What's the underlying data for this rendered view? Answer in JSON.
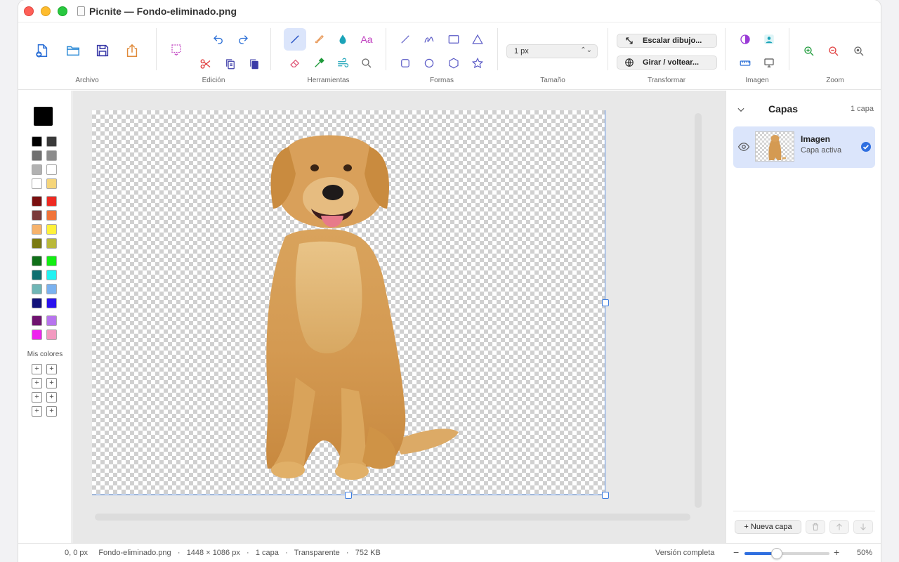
{
  "window": {
    "title": "Picnite — Fondo-eliminado.png"
  },
  "toolbar": {
    "groups": {
      "archivo": "Archivo",
      "edicion": "Edición",
      "herramientas": "Herramientas",
      "formas": "Formas",
      "tamano": "Tamaño",
      "transformar": "Transformar",
      "imagen": "Imagen",
      "zoom": "Zoom"
    },
    "size_value": "1 px",
    "scale_label": "Escalar dibujo...",
    "rotate_label": "Girar / voltear...",
    "text_tool_label": "Aa"
  },
  "colors": {
    "current": "#000000",
    "palette": [
      [
        "#000000",
        "#3a3a3a"
      ],
      [
        "#707070",
        "#8c8c8c"
      ],
      [
        "#b2b2b2",
        "#ffffff"
      ],
      [
        "#ffffff",
        "#f5d57a"
      ],
      [
        "#7a1010",
        "#ee2a22"
      ],
      [
        "#7a3a3a",
        "#f0743a"
      ],
      [
        "#f6b26b",
        "#fff13a"
      ],
      [
        "#7a7a12",
        "#b9b83a"
      ],
      [
        "#0f6f18",
        "#12ee12"
      ],
      [
        "#0f6f70",
        "#22f2f2"
      ],
      [
        "#6fb6b6",
        "#7ab2f0"
      ],
      [
        "#12127a",
        "#2a12ee"
      ],
      [
        "#6f126f",
        "#b774ee"
      ],
      [
        "#ee22ee",
        "#f29ac0"
      ]
    ],
    "my_colors_label": "Mis colores"
  },
  "layers": {
    "title": "Capas",
    "count": "1 capa",
    "items": [
      {
        "name": "Imagen",
        "subtitle": "Capa activa"
      }
    ],
    "new_layer_label": "+ Nueva capa"
  },
  "status": {
    "coords": "0, 0 px",
    "filename": "Fondo-eliminado.png",
    "dimensions": "1448 × 1086 px",
    "layers": "1 capa",
    "background": "Transparente",
    "filesize": "752 KB",
    "separator": "·",
    "version": "Versión completa",
    "zoom": "50%",
    "zoom_fraction": 0.38
  },
  "accent": "#2f6fe0"
}
